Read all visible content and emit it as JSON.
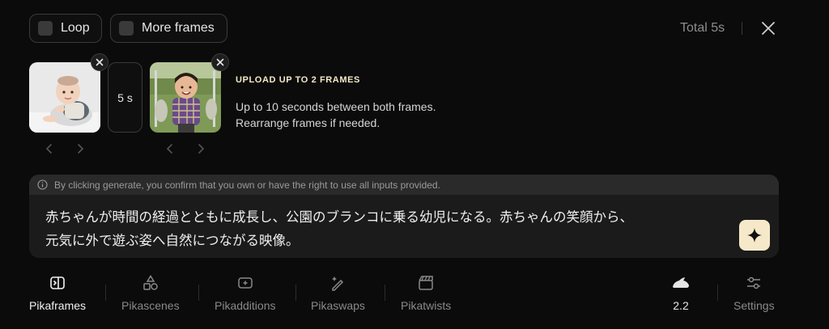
{
  "toolbar": {
    "loop_label": "Loop",
    "more_frames_label": "More frames",
    "total": "Total 5s"
  },
  "frames": {
    "duration": "5 s",
    "upload_title": "UPLOAD UP TO 2 FRAMES",
    "upload_desc_line1": "Up to 10 seconds between both frames.",
    "upload_desc_line2": "Rearrange frames if needed."
  },
  "prompt": {
    "notice": "By clicking generate, you confirm that you own or have the right to use all inputs provided.",
    "line1": "赤ちゃんが時間の経過とともに成長し、公園のブランコに乗る幼児になる。赤ちゃんの笑顔から、",
    "line2": "元気に外で遊ぶ姿へ自然につながる映像。"
  },
  "tabs": [
    {
      "label": "Pikaframes",
      "icon": "pikaframes-icon",
      "active": true
    },
    {
      "label": "Pikascenes",
      "icon": "pikascenes-icon"
    },
    {
      "label": "Pikadditions",
      "icon": "pikadditions-icon"
    },
    {
      "label": "Pikaswaps",
      "icon": "pikaswaps-icon"
    },
    {
      "label": "Pikatwists",
      "icon": "pikatwists-icon"
    }
  ],
  "model": {
    "version": "2.2",
    "icon": "rabbit-icon"
  },
  "settings": {
    "label": "Settings",
    "icon": "settings-icon"
  },
  "colors": {
    "accent": "#f5e9c9",
    "background": "#0b0b0b",
    "panel": "#1b1b1b"
  }
}
